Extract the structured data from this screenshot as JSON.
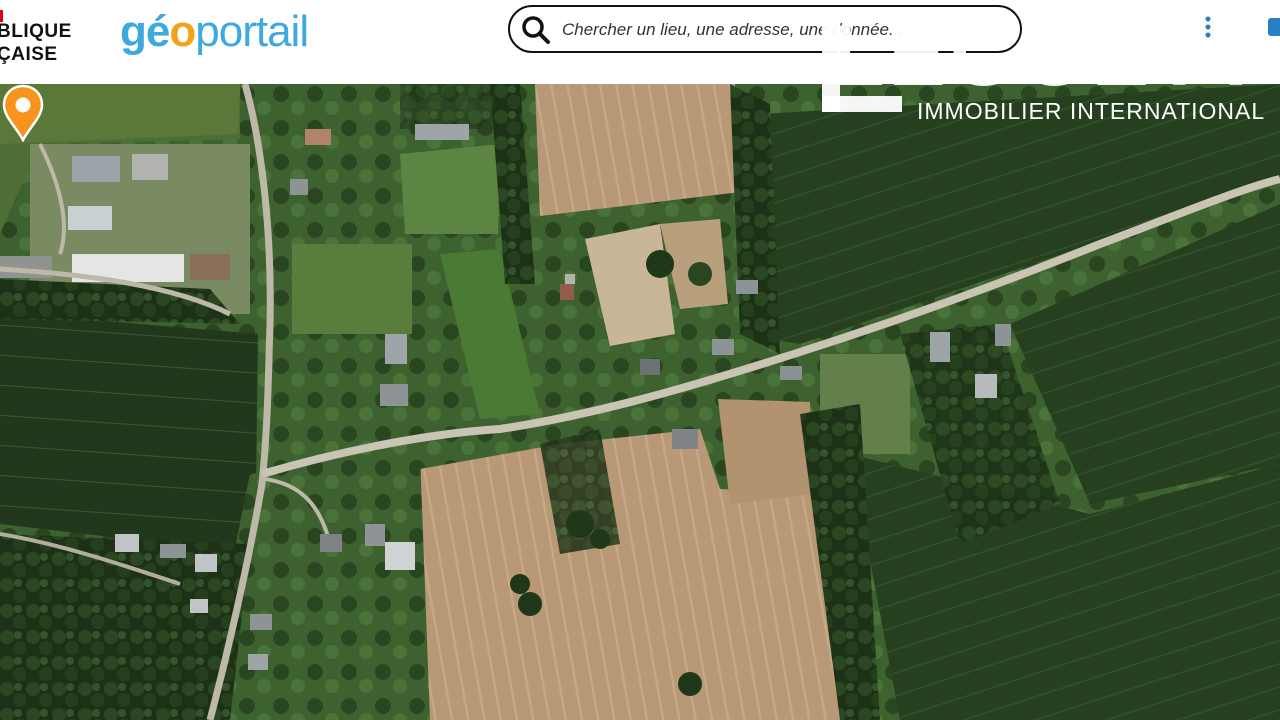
{
  "header": {
    "republic_line1": "BLIQUE",
    "republic_line2": "ÇAISE",
    "brand_part1": "gé",
    "brand_part2": "o",
    "brand_part3": "portail"
  },
  "search": {
    "placeholder": "Chercher un lieu, une adresse, une donnée..."
  },
  "watermark": {
    "brand": "LEGGETT",
    "tagline": "IMMOBILIER INTERNATIONAL"
  },
  "map": {
    "marker_color": "#f7941d",
    "field_dark": "#27401f",
    "field_plowed": "#b99a78",
    "road_color": "#c9c4b4"
  }
}
